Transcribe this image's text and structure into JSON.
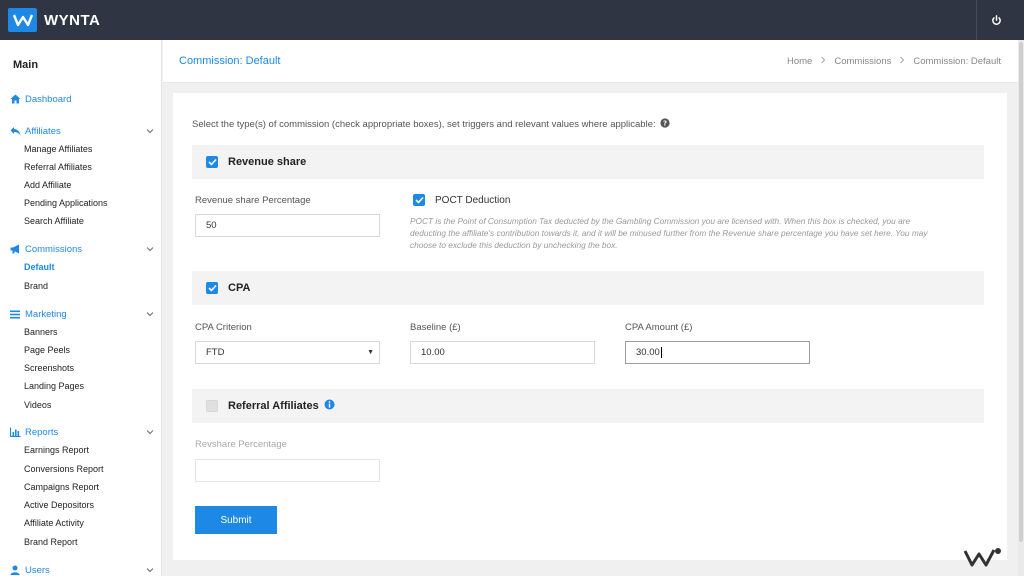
{
  "app": {
    "brand_name": "WYNTA",
    "brand_color": "#1e88e5",
    "topbar_color": "#2f3542"
  },
  "sidebar": {
    "heading": "Main",
    "dashboard": {
      "label": "Dashboard",
      "icon": "home-icon"
    },
    "affiliates": {
      "label": "Affiliates",
      "icon": "reply-icon",
      "items": [
        "Manage Affiliates",
        "Referral Affiliates",
        "Add Affiliate",
        "Pending Applications",
        "Search Affiliate"
      ]
    },
    "commissions": {
      "label": "Commissions",
      "icon": "megaphone-icon",
      "items": [
        "Default",
        "Brand"
      ],
      "active_item": "Default"
    },
    "marketing": {
      "label": "Marketing",
      "icon": "menu-icon",
      "items": [
        "Banners",
        "Page Peels",
        "Screenshots",
        "Landing Pages",
        "Videos"
      ]
    },
    "reports": {
      "label": "Reports",
      "icon": "bar-chart-icon",
      "items": [
        "Earnings Report",
        "Conversions Report",
        "Campaigns Report",
        "Active Depositors",
        "Affiliate Activity",
        "Brand Report"
      ]
    },
    "users": {
      "label": "Users",
      "icon": "user-icon"
    }
  },
  "header": {
    "title": "Commission: Default",
    "breadcrumb": [
      "Home",
      "Commissions",
      "Commission: Default"
    ]
  },
  "form": {
    "intro": "Select the type(s) of commission (check appropriate boxes), set triggers and relevant values where applicable:",
    "revenue_share": {
      "title": "Revenue share",
      "checked": true,
      "percentage_label": "Revenue share Percentage",
      "percentage_value": "50",
      "poct_label": "POCT Deduction",
      "poct_checked": true,
      "poct_description": "POCT is the Point of Consumption Tax deducted by the Gambling Commission you are licensed with. When this box is checked, you are deducting the affiliate's contribution towards it, and it will be minused further from the Revenue share percentage you have set here. You may choose to exclude this deduction by unchecking the box."
    },
    "cpa": {
      "title": "CPA",
      "checked": true,
      "criterion_label": "CPA Criterion",
      "criterion_value": "FTD",
      "baseline_label": "Baseline (£)",
      "baseline_value": "10.00",
      "amount_label": "CPA Amount (£)",
      "amount_value": "30.00"
    },
    "referral": {
      "title": "Referral Affiliates",
      "checked": false,
      "percentage_label": "Revshare Percentage",
      "percentage_value": ""
    },
    "submit_label": "Submit"
  }
}
